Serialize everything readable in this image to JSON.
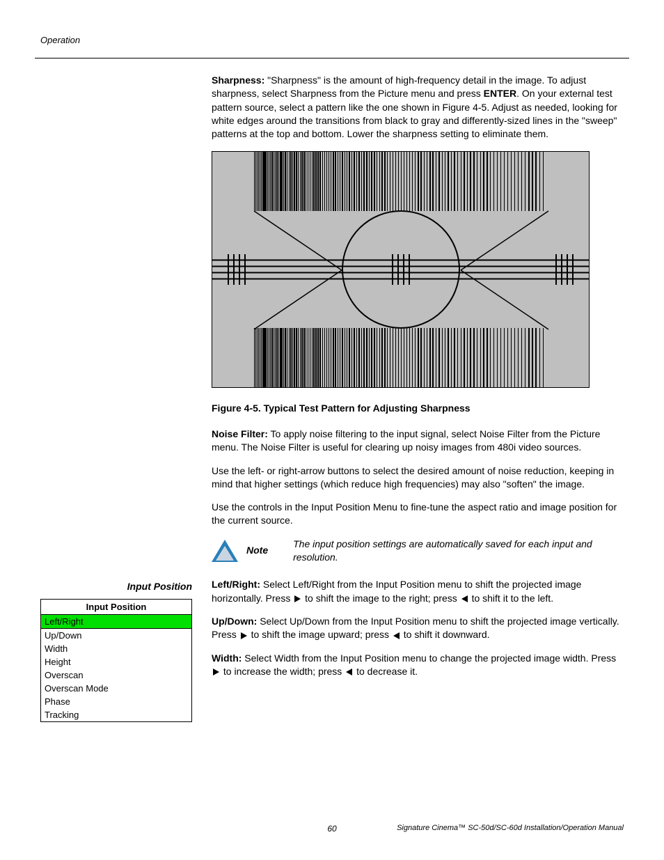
{
  "header": {
    "section": "Operation"
  },
  "sharpness": {
    "label": "Sharpness:",
    "text1": " \"Sharpness\" is the amount of high-frequency detail in the image. To adjust sharpness, select Sharpness from the Picture menu and press ",
    "enter": "ENTER",
    "text2": ". On your external test pattern source, select a pattern like the one shown in Figure 4-5. Adjust as needed, looking for white edges around the transitions from black to gray and differently-sized lines in the \"sweep\" patterns at the top and bottom. Lower the sharpness setting to eliminate them."
  },
  "figure": {
    "caption": "Figure 4-5. Typical Test Pattern for Adjusting Sharpness"
  },
  "noise": {
    "label": "Noise Filter:",
    "text": " To apply noise filtering to the input signal, select Noise Filter from the Picture menu. The Noise Filter is useful for clearing up noisy images from 480i video sources."
  },
  "noise2": "Use the left- or right-arrow buttons to select the desired amount of noise reduction, keeping in mind that higher settings (which reduce high frequencies) may also \"soften\" the image.",
  "inputpos": {
    "heading": "Input Position",
    "intro": "Use the controls in the Input Position Menu to fine-tune the aspect ratio and image position for the current source.",
    "note_label": "Note",
    "note_text": "The input position settings are automatically saved for each input and resolution."
  },
  "menu": {
    "title": "Input Position",
    "items": [
      "Left/Right",
      "Up/Down",
      "Width",
      "Height",
      "Overscan",
      "Overscan Mode",
      "Phase",
      "Tracking"
    ]
  },
  "lr": {
    "label": "Left/Right:",
    "t1": " Select Left/Right from the Input Position menu to shift the projected image horizontally. Press ",
    "t2": " to shift the image to the right; press ",
    "t3": " to shift it to the left."
  },
  "ud": {
    "label": "Up/Down:",
    "t1": " Select Up/Down from the Input Position menu to shift the projected image vertically. Press ",
    "t2": " to shift the image upward; press ",
    "t3": " to shift it downward."
  },
  "width": {
    "label": "Width:",
    "t1": " Select Width from the Input Position menu to change the projected image width. Press ",
    "t2": " to increase the width; press ",
    "t3": " to decrease it."
  },
  "footer": {
    "page": "60",
    "text": "Signature Cinema™ SC-50d/SC-60d Installation/Operation Manual"
  }
}
